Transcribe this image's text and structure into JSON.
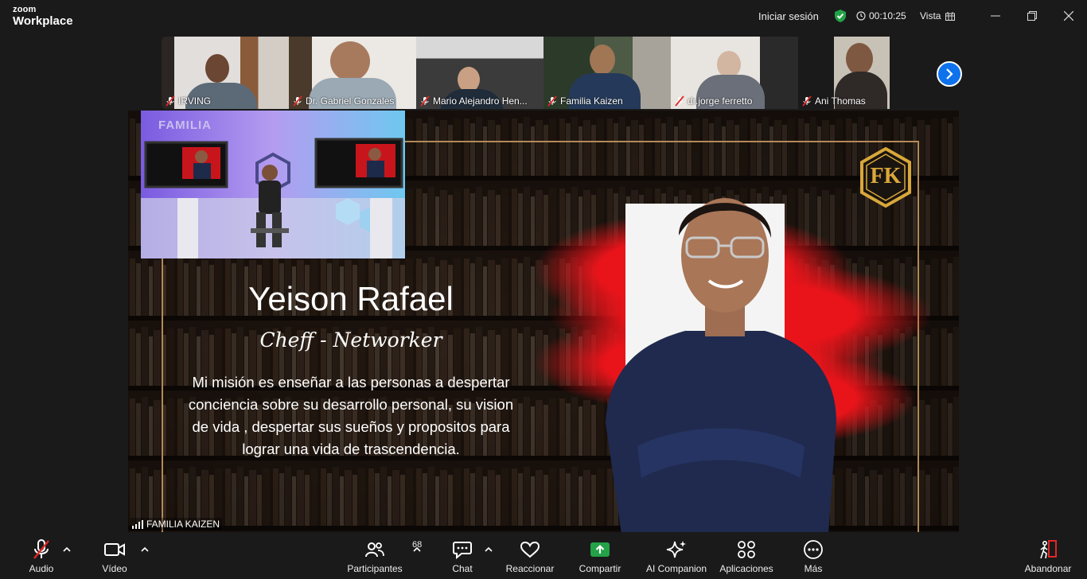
{
  "app": {
    "brand_small": "zoom",
    "brand_large": "Workplace"
  },
  "header": {
    "signin": "Iniciar sesión",
    "timer": "00:10:25",
    "view": "Vista"
  },
  "participants_strip": [
    {
      "name": "IRVING",
      "muted": true
    },
    {
      "name": "Dr. Gabriel Gonzales",
      "muted": true
    },
    {
      "name": "Mario Alejandro Hen...",
      "muted": true
    },
    {
      "name": "Familia Kaizen",
      "muted": true
    },
    {
      "name": "dr.jorge ferretto",
      "muted": true
    },
    {
      "name": "Ani Thomas",
      "muted": true
    }
  ],
  "share": {
    "inset_label": "FAMILIA",
    "title": "Yeison Rafael",
    "subtitle": "Cheff - Networker",
    "mission": "Mi misión es enseñar a las personas a despertar conciencia sobre su desarrollo personal, su vision de vida , despertar sus sueños y propositos para lograr una vida de trascendencia.",
    "logo_text": "FK",
    "sharer": "FAMILIA KAIZEN"
  },
  "toolbar": {
    "audio": "Audio",
    "video": "Vídeo",
    "participants": "Participantes",
    "participants_count": "68",
    "chat": "Chat",
    "react": "Reaccionar",
    "share": "Compartir",
    "companion": "AI Companion",
    "apps": "Aplicaciones",
    "more": "Más",
    "leave": "Abandonar"
  },
  "colors": {
    "accent": "#0e72ed",
    "share_green": "#23a247",
    "leave_red": "#e02828",
    "frame_gold": "#b48a58"
  }
}
